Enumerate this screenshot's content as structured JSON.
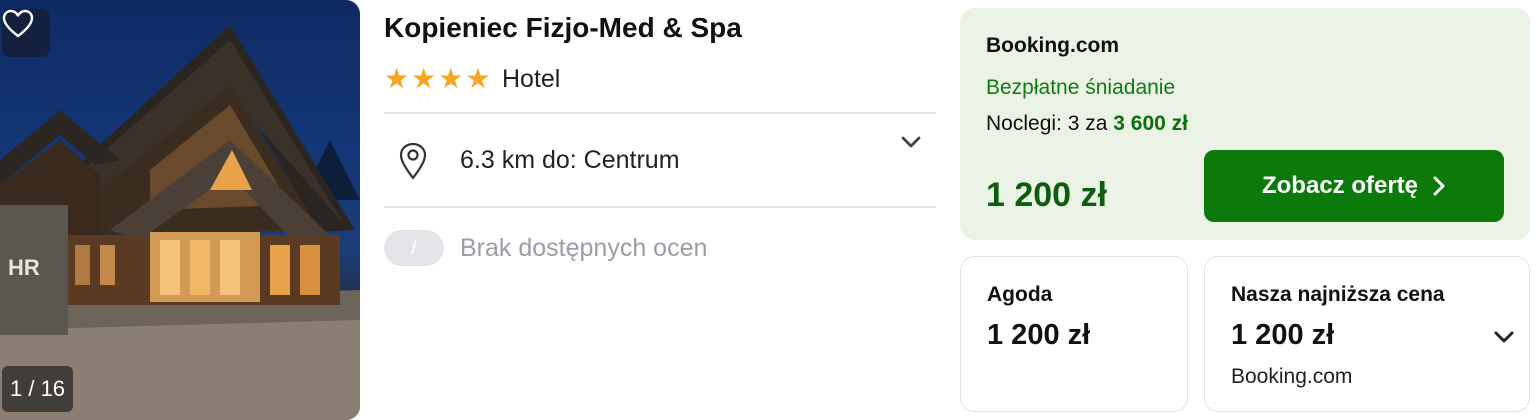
{
  "gallery": {
    "counter": "1 / 16",
    "favorite_icon": "heart-outline-icon"
  },
  "hotel": {
    "name": "Kopieniec Fizjo-Med & Spa",
    "stars": 4,
    "type": "Hotel",
    "location_icon": "map-pin-icon",
    "distance_text": "6.3 km do: Centrum",
    "rating_badge": "/",
    "rating_text": "Brak dostępnych ocen"
  },
  "main_offer": {
    "provider": "Booking.com",
    "perk": "Bezpłatne śniadanie",
    "nights_label": "Noclegi: 3 za",
    "nights_total": "3 600 zł",
    "price": "1 200 zł",
    "cta_label": "Zobacz ofertę",
    "colors": {
      "background": "#ebf3e6",
      "accent": "#0b7a0b"
    }
  },
  "other_offers": [
    {
      "title": "Agoda",
      "price": "1 200 zł"
    },
    {
      "title": "Nasza najniższa cena",
      "price": "1 200 zł",
      "provider": "Booking.com"
    }
  ]
}
